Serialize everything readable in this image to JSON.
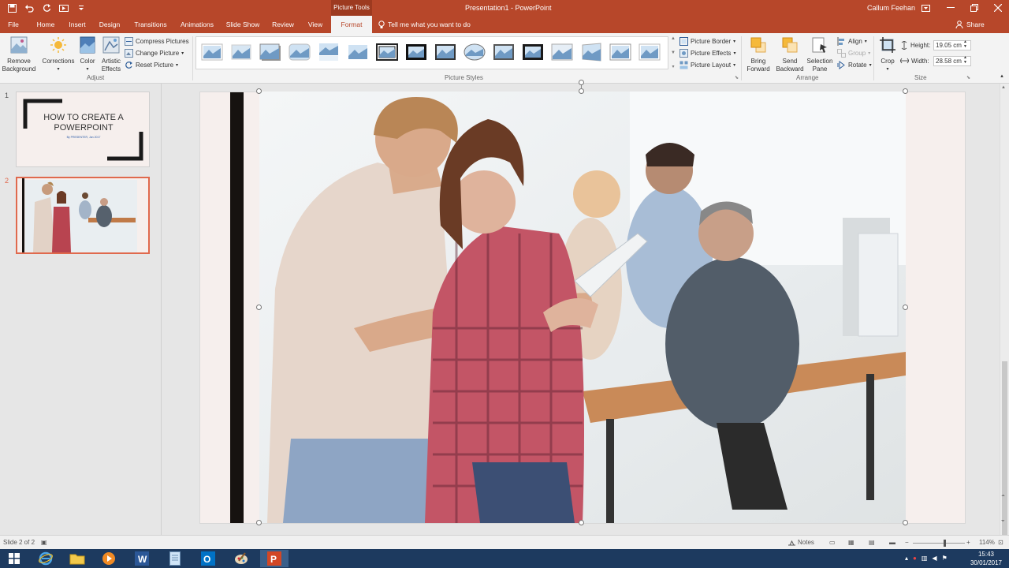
{
  "window": {
    "doc_title": "Presentation1 - PowerPoint",
    "context_title": "Picture Tools",
    "user_name": "Callum Feehan"
  },
  "tabs": [
    {
      "label": "File"
    },
    {
      "label": "Home"
    },
    {
      "label": "Insert"
    },
    {
      "label": "Design"
    },
    {
      "label": "Transitions"
    },
    {
      "label": "Animations"
    },
    {
      "label": "Slide Show"
    },
    {
      "label": "Review"
    },
    {
      "label": "View"
    },
    {
      "label": "Format"
    }
  ],
  "tellme": "Tell me what you want to do",
  "share": "Share",
  "ribbon": {
    "adjust": {
      "remove_background": "Remove Background",
      "corrections": "Corrections",
      "color": "Color",
      "artistic_effects": "Artistic Effects",
      "compress_pictures": "Compress Pictures",
      "change_picture": "Change Picture",
      "reset_picture": "Reset Picture",
      "group_label": "Adjust"
    },
    "picture_styles": {
      "group_label": "Picture Styles",
      "picture_border": "Picture Border",
      "picture_effects": "Picture Effects",
      "picture_layout": "Picture Layout"
    },
    "arrange": {
      "bring_forward": "Bring Forward",
      "send_backward": "Send Backward",
      "selection_pane": "Selection Pane",
      "align": "Align",
      "group": "Group",
      "rotate": "Rotate",
      "group_label": "Arrange"
    },
    "size": {
      "crop": "Crop",
      "height_label": "Height:",
      "height_value": "19.05 cm",
      "width_label": "Width:",
      "width_value": "28.58 cm",
      "group_label": "Size"
    }
  },
  "slides": [
    {
      "number": "1",
      "title": "HOW TO CREATE A POWERPOINT",
      "subtitle": "By PRESENTER, Jan 2017"
    },
    {
      "number": "2"
    }
  ],
  "status": {
    "slide_counter": "Slide 2 of 2",
    "notes": "Notes",
    "zoom": "114%",
    "zoom_level": 0.6
  },
  "taskbar": {
    "time": "15:43",
    "date": "30/01/2017"
  },
  "colors": {
    "accent": "#b7472a",
    "active_tab_text": "#b7472a",
    "taskbar": "#1d3a5f"
  }
}
